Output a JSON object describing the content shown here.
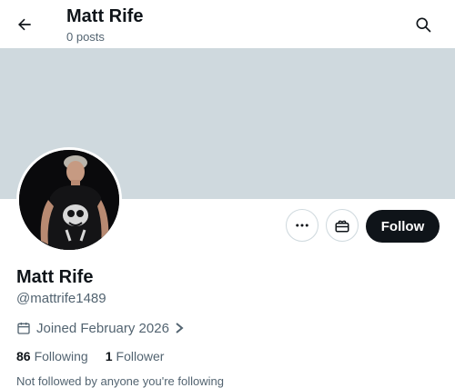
{
  "header": {
    "title": "Matt Rife",
    "subtitle": "0 posts",
    "back_icon": "arrow-left-icon",
    "search_icon": "search-icon"
  },
  "banner": {
    "color": "#cfd9de"
  },
  "profile": {
    "name": "Matt Rife",
    "handle": "@mattrife1489",
    "joined": "Joined February 2026",
    "following_count": "86",
    "following_label": "Following",
    "followers_count": "1",
    "followers_label": "Follower",
    "followed_by": "Not followed by anyone you're following"
  },
  "actions": {
    "more_icon": "more-dots-icon",
    "gift_icon": "gift-icon",
    "follow_label": "Follow"
  },
  "colors": {
    "text_primary": "#0f1419",
    "text_secondary": "#536471",
    "button_dark": "#0f1419",
    "border": "#cfd9de"
  }
}
